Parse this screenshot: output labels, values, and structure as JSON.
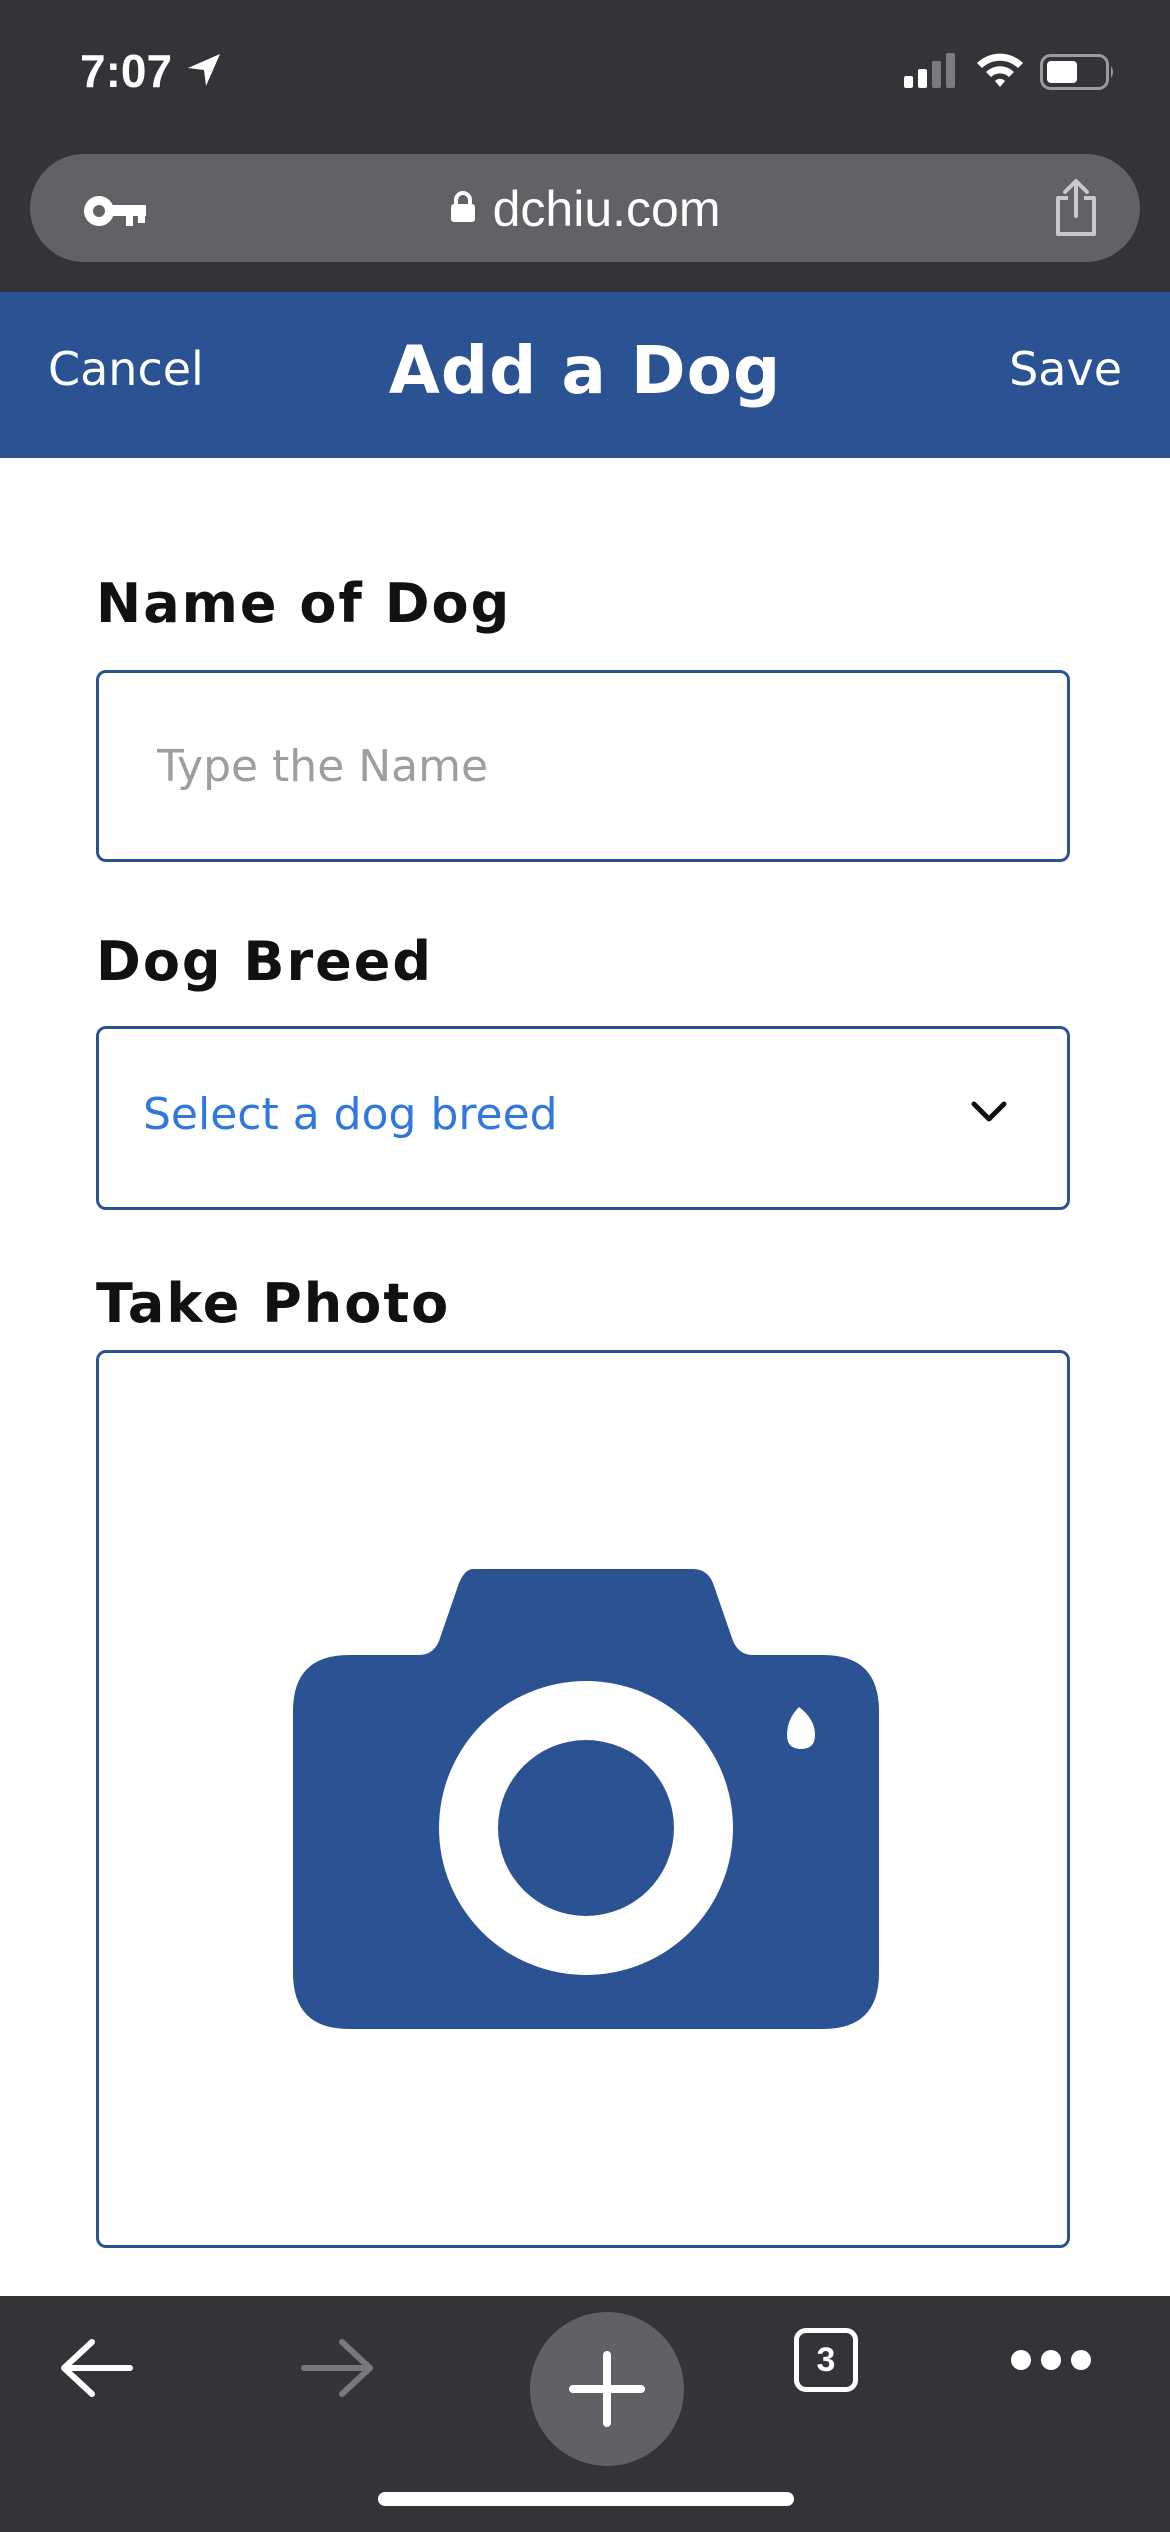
{
  "status_bar": {
    "time": "7:07",
    "icons": [
      "location-arrow-icon",
      "signal-icon",
      "wifi-icon",
      "battery-icon"
    ]
  },
  "browser": {
    "url": "dchiu.com",
    "open_tabs": "3",
    "icons": [
      "key-icon",
      "lock-icon",
      "share-icon",
      "back-arrow-icon",
      "forward-arrow-icon",
      "plus-icon",
      "tabs-icon",
      "more-icon"
    ]
  },
  "header": {
    "cancel_label": "Cancel",
    "title": "Add a Dog",
    "save_label": "Save"
  },
  "form": {
    "name_label": "Name of Dog",
    "name_placeholder": "Type the Name",
    "name_value": "",
    "breed_label": "Dog Breed",
    "breed_selected": "Select a dog breed",
    "photo_label": "Take Photo"
  },
  "colors": {
    "primary": "#2b5394",
    "browser_chrome": "#333437",
    "select_text": "#3077e0"
  }
}
